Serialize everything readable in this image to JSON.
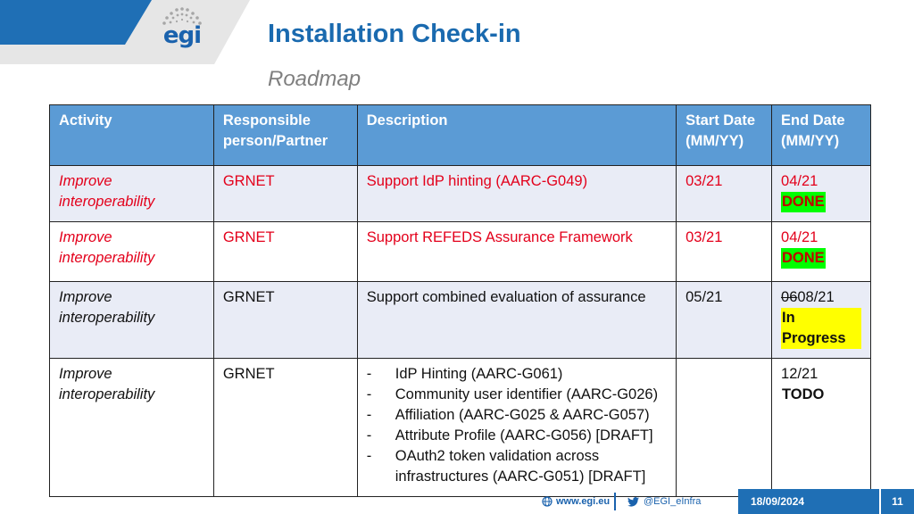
{
  "header": {
    "logo_text": "egi",
    "title": "Installation Check-in",
    "subtitle": "Roadmap"
  },
  "table": {
    "columns": [
      "Activity",
      "Responsible person/Partner",
      "Description",
      "Start Date (MM/YY)",
      "End Date (MM/YY)"
    ],
    "rows": [
      {
        "activity": "Improve interoperability",
        "partner": "GRNET",
        "description": "Support IdP hinting (AARC-G049)",
        "start": "03/21",
        "end": "04/21",
        "status": "DONE"
      },
      {
        "activity": "Improve interoperability",
        "partner": "GRNET",
        "description": "Support REFEDS Assurance Framework",
        "start": "03/21",
        "end": "04/21",
        "status": "DONE"
      },
      {
        "activity": "Improve interoperability",
        "partner": "GRNET",
        "description": "Support combined evaluation of assurance",
        "start": "05/21",
        "end_struck": "06",
        "end": "08/21",
        "status": "In Progress"
      },
      {
        "activity": "Improve interoperability",
        "partner": "GRNET",
        "description_items": [
          "IdP Hinting (AARC-G061)",
          "Community user identifier (AARC-G026)",
          "Affiliation (AARC-G025 & AARC-G057)",
          "Attribute Profile (AARC-G056) [DRAFT]",
          "OAuth2 token validation across infrastructures (AARC-G051) [DRAFT]"
        ],
        "start": "",
        "end": "12/21",
        "status": "TODO"
      }
    ]
  },
  "footer": {
    "website": "www.egi.eu",
    "twitter": "@EGI_eInfra",
    "date": "18/09/2024",
    "page": "11"
  },
  "colors": {
    "brand_blue": "#1f6fb5",
    "header_blue": "#5b9bd5",
    "done_green": "#00ff00",
    "progress_yellow": "#ffff00",
    "alert_red": "#e3001b"
  }
}
